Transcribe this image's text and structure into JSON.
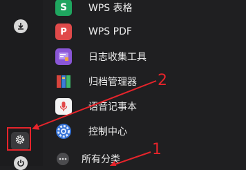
{
  "apps": [
    {
      "label": "WPS 表格",
      "icon": "wps-spreadsheet-icon",
      "color": "#1fa55f",
      "glyph": "S"
    },
    {
      "label": "WPS PDF",
      "icon": "wps-pdf-icon",
      "color": "#e04a4a",
      "glyph": "P"
    },
    {
      "label": "日志收集工具",
      "icon": "log-collector-icon",
      "color": "#8a56d6",
      "glyph": ""
    },
    {
      "label": "归档管理器",
      "icon": "archive-manager-icon",
      "color": "#d8443c",
      "glyph": ""
    },
    {
      "label": "语音记事本",
      "icon": "voice-notepad-icon",
      "color": "#e24747",
      "glyph": ""
    },
    {
      "label": "控制中心",
      "icon": "control-center-icon",
      "color": "#3572d6",
      "glyph": ""
    }
  ],
  "all_categories": {
    "label": "所有分类"
  },
  "sidebar": {
    "download_icon": "download-icon",
    "settings_icon": "settings-gear-icon",
    "power_icon": "power-icon"
  },
  "annotations": {
    "callout_1": "1",
    "callout_2": "2",
    "color": "#e6242b"
  }
}
